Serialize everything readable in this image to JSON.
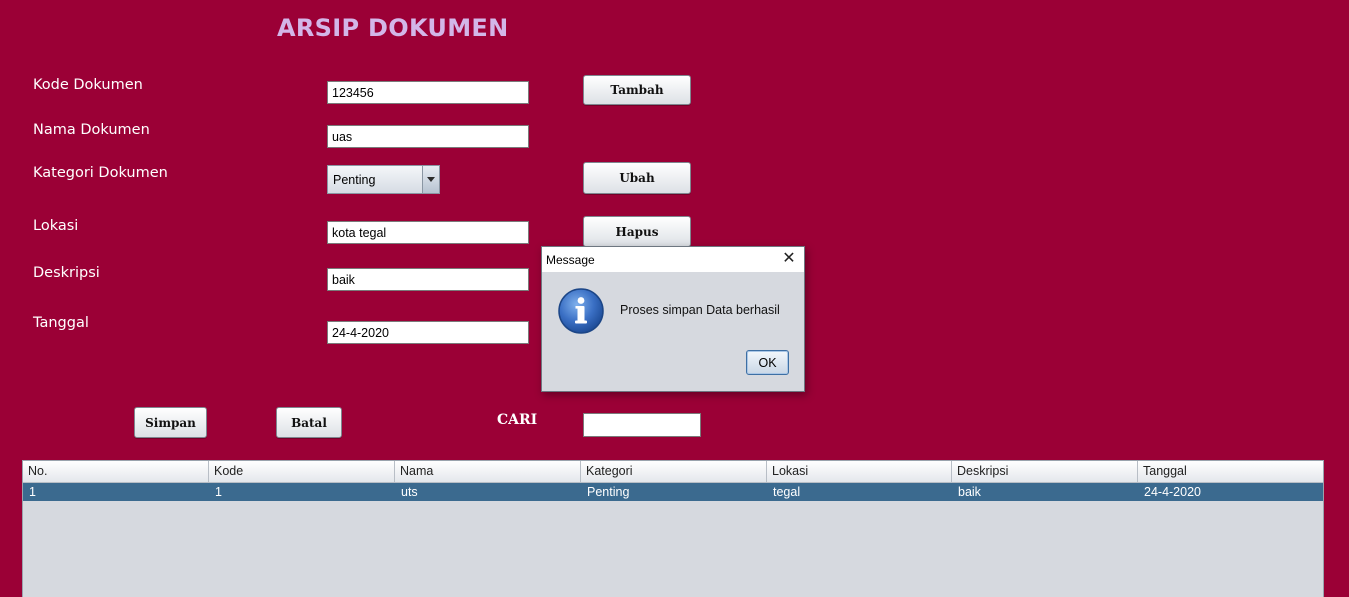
{
  "app": {
    "title": "ARSIP DOKUMEN"
  },
  "form": {
    "kode": {
      "label": "Kode Dokumen",
      "value": "123456"
    },
    "nama": {
      "label": "Nama Dokumen",
      "value": "uas"
    },
    "kategori": {
      "label": "Kategori Dokumen",
      "value": "Penting"
    },
    "lokasi": {
      "label": "Lokasi",
      "value": "kota tegal"
    },
    "deskripsi": {
      "label": "Deskripsi",
      "value": "baik"
    },
    "tanggal": {
      "label": "Tanggal",
      "value": "24-4-2020"
    }
  },
  "buttons": {
    "tambah": "Tambah",
    "ubah": "Ubah",
    "hapus": "Hapus",
    "simpan": "Simpan",
    "batal": "Batal"
  },
  "search": {
    "label": "CARI",
    "value": ""
  },
  "table": {
    "columns": [
      "No.",
      "Kode",
      "Nama",
      "Kategori",
      "Lokasi",
      "Deskripsi",
      "Tanggal"
    ],
    "rows": [
      [
        "1",
        "1",
        "uts",
        "Penting",
        "tegal",
        "baik",
        "24-4-2020"
      ]
    ]
  },
  "dialog": {
    "title": "Message",
    "close": "✕",
    "message": "Proses simpan Data berhasil",
    "ok": "OK",
    "icon": "info-icon"
  },
  "colors": {
    "background": "#9b0036",
    "title": "#d3b6e8",
    "selected_row": "#3b6a8f"
  }
}
